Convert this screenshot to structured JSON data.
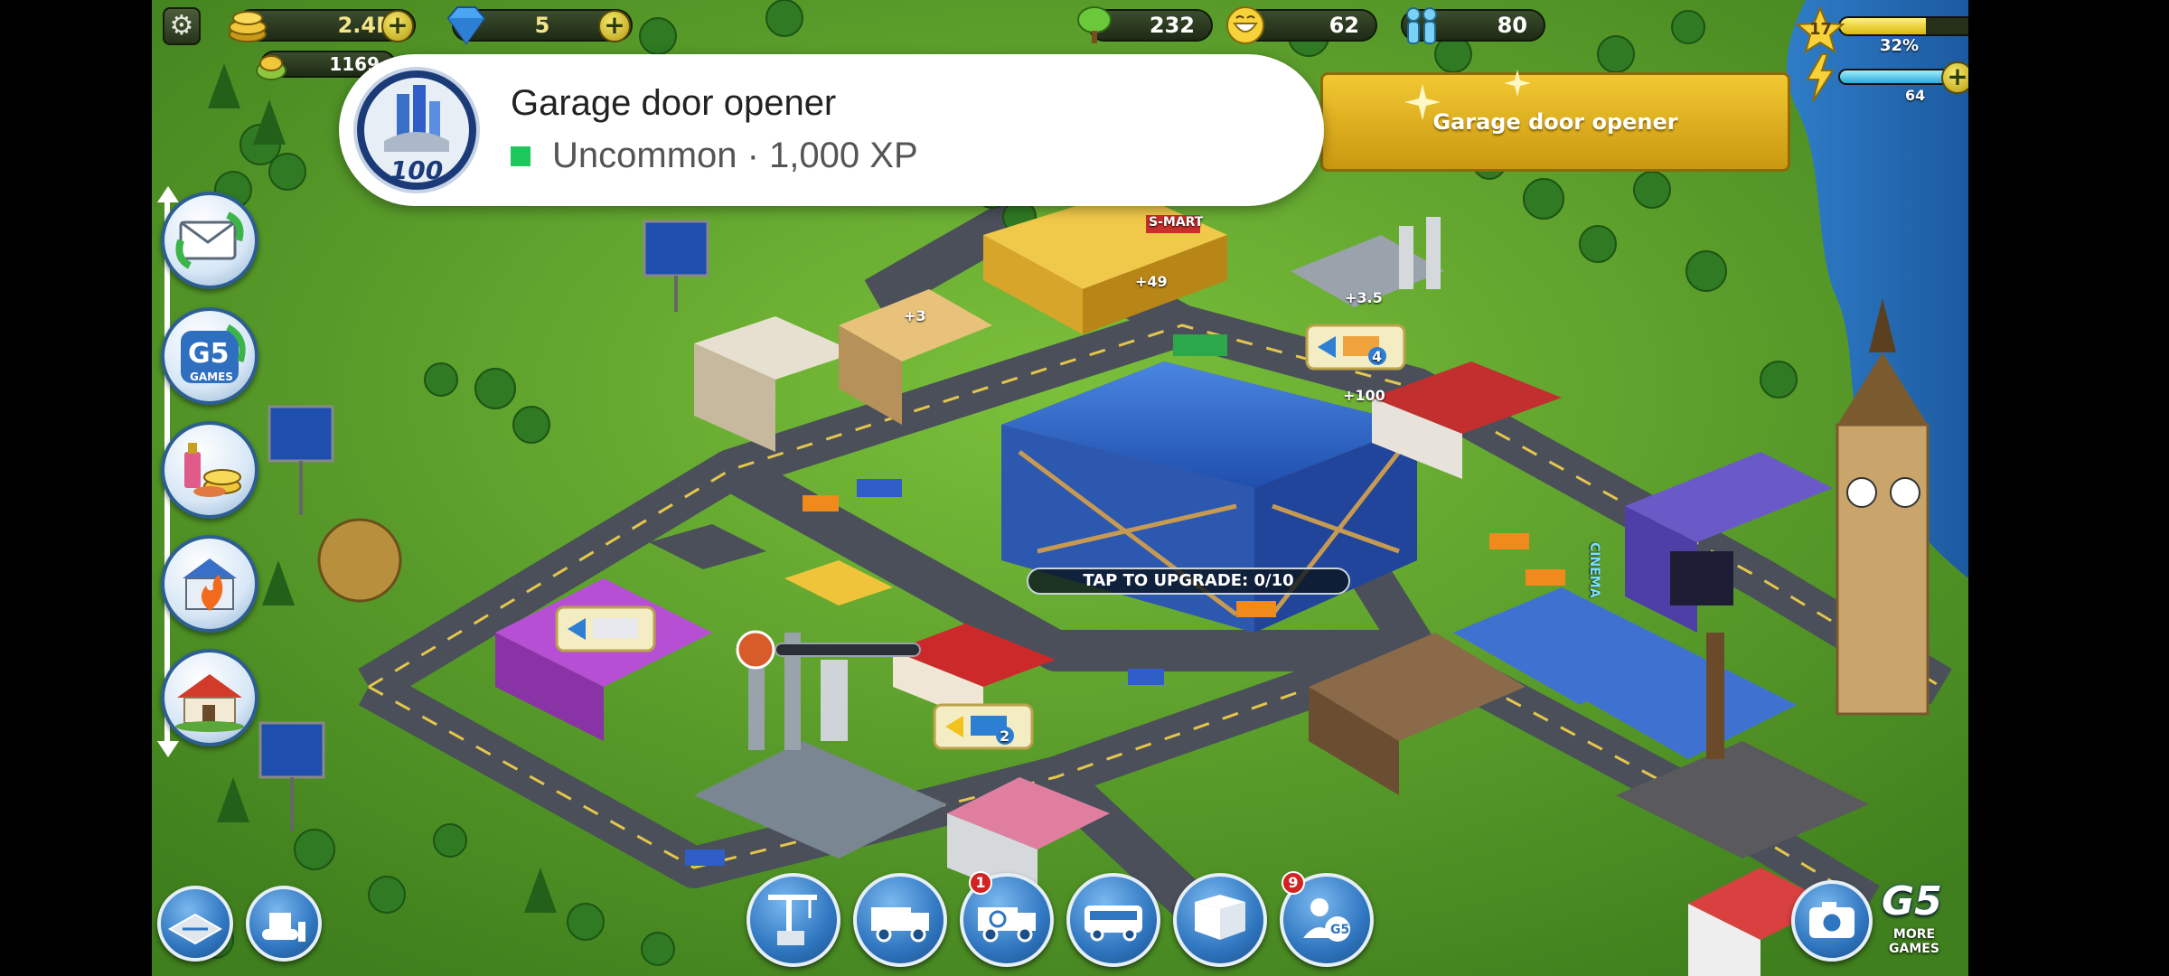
{
  "hud": {
    "coins": "2.4M",
    "gems": "5",
    "sub_coins": "1169",
    "trees": "232",
    "happiness": "62",
    "population": "80",
    "level": "17",
    "xp_percent_label": "32%",
    "xp_fraction": 0.32,
    "energy": "64",
    "energy_fraction": 0.62
  },
  "notification": {
    "title": "Garage door opener",
    "subtitle": "Uncommon · 1,000 XP",
    "badge_number": "100",
    "rarity_color": "#1ec85c"
  },
  "banner": {
    "text": "Garage door opener"
  },
  "world": {
    "upgrade_prompt": "TAP TO UPGRADE: 0/10",
    "cinema_sign": "CINEMA",
    "mart_sign": "S-MART",
    "floating_values": [
      "+49",
      "+3.5",
      "+100",
      "+3"
    ],
    "delivery_counts": [
      "4",
      "2"
    ]
  },
  "side_menu": {
    "g5_label": "G5",
    "g5_sub": "GAMES"
  },
  "bottom_bar": {
    "recycle_badge": "1",
    "social_badge": "9"
  },
  "branding": {
    "more_games_logo": "G5",
    "more_games_text": "MORE GAMES"
  }
}
